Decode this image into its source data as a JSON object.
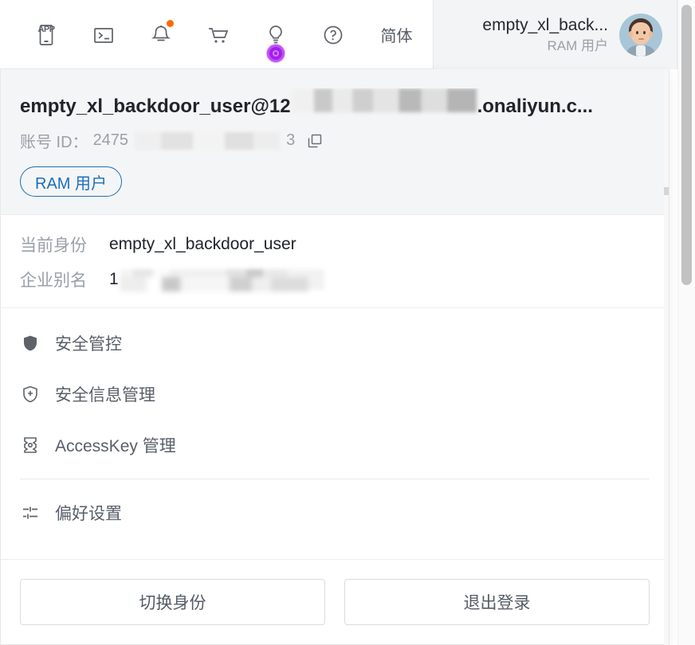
{
  "topbar": {
    "icons": [
      {
        "name": "app-icon",
        "label": "APP"
      },
      {
        "name": "console-terminal-icon",
        "label": ""
      },
      {
        "name": "notification-bell-icon",
        "label": "",
        "has_badge": true,
        "badge_color": "#ff6a00"
      },
      {
        "name": "shopping-cart-icon",
        "label": ""
      },
      {
        "name": "lightbulb-icon",
        "label": "",
        "cursor_highlight": true,
        "cursor_color": "#a020f0"
      },
      {
        "name": "help-question-icon",
        "label": ""
      }
    ],
    "language": "简体",
    "user": {
      "name": "empty_xl_back...",
      "role": "RAM 用户"
    }
  },
  "panel": {
    "header": {
      "email_prefix": "empty_xl_backdoor_user@12",
      "email_suffix": ".onaliyun.c...",
      "account_id_label": "账号 ID：",
      "account_id_prefix": "2475",
      "account_id_suffix": "3",
      "copy_icon": "copy-icon",
      "badge": "RAM 用户",
      "badge_color": "#1d6fb8"
    },
    "identity": [
      {
        "label": "当前身份",
        "value": "empty_xl_backdoor_user",
        "masked": false
      },
      {
        "label": "企业别名",
        "value": "1",
        "masked": true
      }
    ],
    "menu": [
      {
        "icon": "shield-icon",
        "label": "安全管控"
      },
      {
        "icon": "shield-plus-icon",
        "label": "安全信息管理"
      },
      {
        "icon": "accesskey-icon",
        "label": "AccessKey 管理"
      }
    ],
    "menu_secondary": [
      {
        "icon": "sliders-icon",
        "label": "偏好设置"
      }
    ],
    "footer": {
      "switch_identity": "切换身份",
      "logout": "退出登录"
    }
  }
}
